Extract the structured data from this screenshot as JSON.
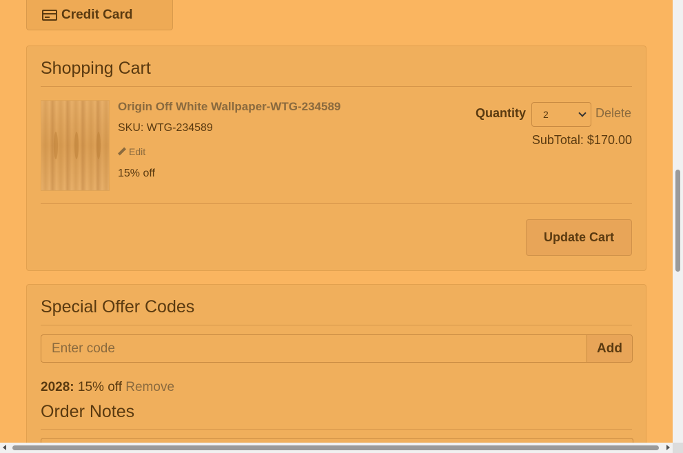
{
  "payment": {
    "credit_card_label": "Credit Card",
    "icon": "credit-card-icon"
  },
  "cart": {
    "title": "Shopping Cart",
    "item": {
      "name": "Origin Off White Wallpaper-WTG-234589",
      "sku": "SKU: WTG-234589",
      "edit_label": "Edit",
      "discount": "15% off",
      "quantity_label": "Quantity",
      "quantity_value": "2",
      "delete_label": "Delete",
      "subtotal": "SubTotal: $170.00"
    },
    "update_label": "Update Cart"
  },
  "offers": {
    "title": "Special Offer Codes",
    "input_placeholder": "Enter code",
    "add_label": "Add",
    "applied_code": "2028:",
    "applied_text": " 15% off ",
    "remove_label": "Remove"
  },
  "notes": {
    "title": "Order Notes"
  },
  "colors": {
    "background": "#fab560",
    "panel": "#f0af5c",
    "text": "#5a3a10",
    "link": "#8a6a3e"
  }
}
